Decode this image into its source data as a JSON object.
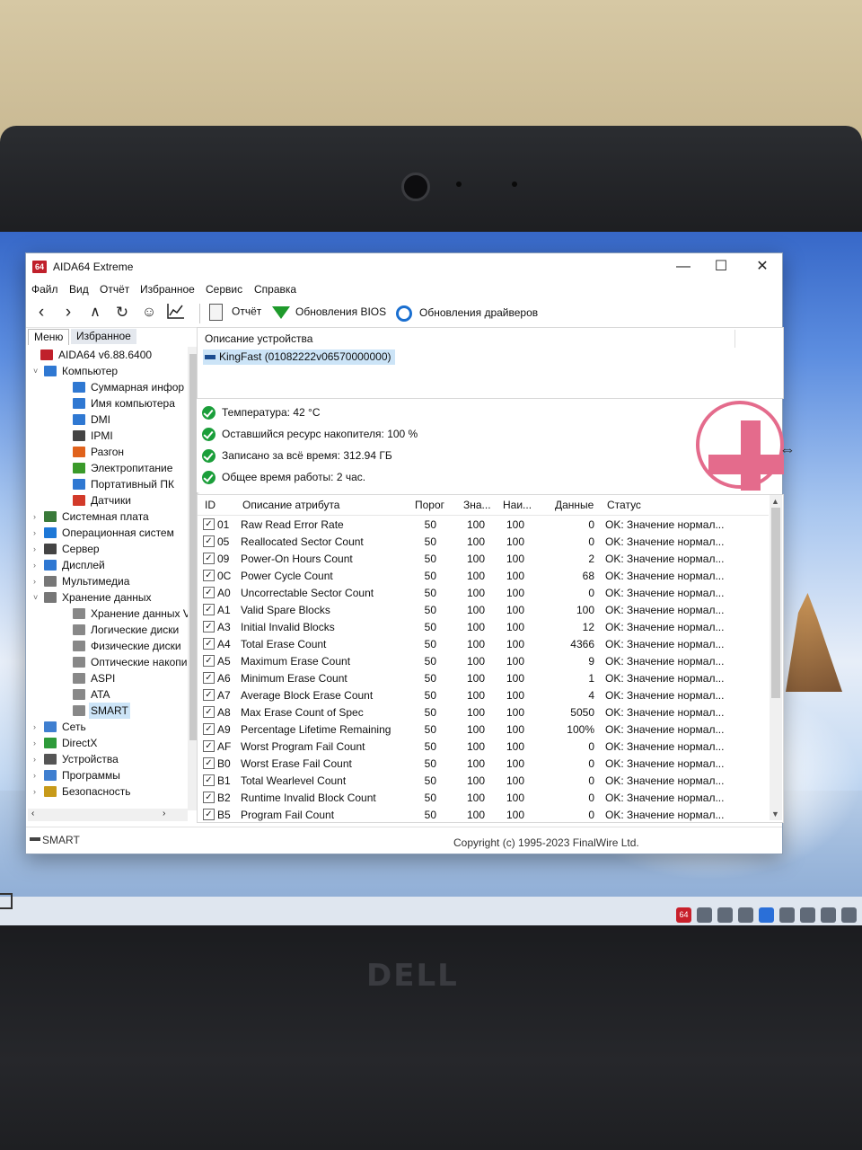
{
  "window": {
    "title": "AIDA64 Extreme",
    "logo": "64",
    "controls": [
      "—",
      "☐",
      "✕"
    ]
  },
  "menu": [
    "Файл",
    "Вид",
    "Отчёт",
    "Избранное",
    "Сервис",
    "Справка"
  ],
  "toolbar": {
    "nav_icons": [
      "back-icon",
      "forward-icon",
      "up-icon",
      "refresh-icon",
      "user-icon",
      "chart-icon"
    ],
    "report_label": "Отчёт",
    "bios_label": "Обновления BIOS",
    "drivers_label": "Обновления драйверов"
  },
  "left_tabs": {
    "menu": "Меню",
    "favorites": "Избранное"
  },
  "tree": [
    {
      "label": "AIDA64 v6.88.6400",
      "indent": 0,
      "expander": "",
      "icon": "aida-icon",
      "color": "#c0202b"
    },
    {
      "label": "Компьютер",
      "indent": 1,
      "expander": "v",
      "icon": "computer-icon",
      "color": "#2f78d2"
    },
    {
      "label": "Суммарная инфор",
      "indent": 2,
      "expander": "",
      "icon": "monitor-icon",
      "color": "#2f78d2"
    },
    {
      "label": "Имя компьютера",
      "indent": 2,
      "expander": "",
      "icon": "monitor-icon",
      "color": "#2f78d2"
    },
    {
      "label": "DMI",
      "indent": 2,
      "expander": "",
      "icon": "monitor-icon",
      "color": "#2f78d2"
    },
    {
      "label": "IPMI",
      "indent": 2,
      "expander": "",
      "icon": "server-icon",
      "color": "#444444"
    },
    {
      "label": "Разгон",
      "indent": 2,
      "expander": "",
      "icon": "flame-icon",
      "color": "#e0621c"
    },
    {
      "label": "Электропитание",
      "indent": 2,
      "expander": "",
      "icon": "power-icon",
      "color": "#3a9a2a"
    },
    {
      "label": "Портативный ПК",
      "indent": 2,
      "expander": "",
      "icon": "laptop-icon",
      "color": "#2f78d2"
    },
    {
      "label": "Датчики",
      "indent": 2,
      "expander": "",
      "icon": "gauge-icon",
      "color": "#d23a2a"
    },
    {
      "label": "Системная плата",
      "indent": 1,
      "expander": ">",
      "icon": "motherboard-icon",
      "color": "#3a7a3a"
    },
    {
      "label": "Операционная систем",
      "indent": 1,
      "expander": ">",
      "icon": "windows-icon",
      "color": "#1e78d7"
    },
    {
      "label": "Сервер",
      "indent": 1,
      "expander": ">",
      "icon": "server-icon",
      "color": "#444444"
    },
    {
      "label": "Дисплей",
      "indent": 1,
      "expander": ">",
      "icon": "display-icon",
      "color": "#2f78d2"
    },
    {
      "label": "Мультимедиа",
      "indent": 1,
      "expander": ">",
      "icon": "speaker-icon",
      "color": "#777777"
    },
    {
      "label": "Хранение данных",
      "indent": 1,
      "expander": "v",
      "icon": "storage-icon",
      "color": "#777777"
    },
    {
      "label": "Хранение данных V",
      "indent": 2,
      "expander": "",
      "icon": "disk-icon",
      "color": "#888888"
    },
    {
      "label": "Логические диски",
      "indent": 2,
      "expander": "",
      "icon": "disk-icon",
      "color": "#888888"
    },
    {
      "label": "Физические диски",
      "indent": 2,
      "expander": "",
      "icon": "disk-icon",
      "color": "#888888"
    },
    {
      "label": "Оптические накопи",
      "indent": 2,
      "expander": "",
      "icon": "optical-icon",
      "color": "#888888"
    },
    {
      "label": "ASPI",
      "indent": 2,
      "expander": "",
      "icon": "disk-icon",
      "color": "#888888"
    },
    {
      "label": "ATA",
      "indent": 2,
      "expander": "",
      "icon": "disk-icon",
      "color": "#888888"
    },
    {
      "label": "SMART",
      "indent": 2,
      "expander": "",
      "icon": "disk-icon",
      "color": "#888888",
      "selected": true
    },
    {
      "label": "Сеть",
      "indent": 1,
      "expander": ">",
      "icon": "network-icon",
      "color": "#3f7fd0"
    },
    {
      "label": "DirectX",
      "indent": 1,
      "expander": ">",
      "icon": "xbox-icon",
      "color": "#2e9b3a"
    },
    {
      "label": "Устройства",
      "indent": 1,
      "expander": ">",
      "icon": "device-icon",
      "color": "#555555"
    },
    {
      "label": "Программы",
      "indent": 1,
      "expander": ">",
      "icon": "programs-icon",
      "color": "#3f7fd0"
    },
    {
      "label": "Безопасность",
      "indent": 1,
      "expander": ">",
      "icon": "shield-icon",
      "color": "#c79a1a"
    }
  ],
  "device_desc": {
    "header": "Описание устройства",
    "device": "KingFast (01082222v06570000000)"
  },
  "summary": [
    "Температура: 42 °C",
    "Оставшийся ресурс накопителя: 100 %",
    "Записано за всё время: 312.94 ГБ",
    "Общее время работы: 2 час."
  ],
  "table": {
    "headers": {
      "id": "ID",
      "desc": "Описание атрибута",
      "thr": "Порог",
      "val": "Зна...",
      "worst": "Наи...",
      "data": "Данные",
      "status": "Статус"
    },
    "rows": [
      {
        "id": "01",
        "desc": "Raw Read Error Rate",
        "thr": "50",
        "val": "100",
        "worst": "100",
        "data": "0",
        "status": "OK: Значение нормал..."
      },
      {
        "id": "05",
        "desc": "Reallocated Sector Count",
        "thr": "50",
        "val": "100",
        "worst": "100",
        "data": "0",
        "status": "OK: Значение нормал..."
      },
      {
        "id": "09",
        "desc": "Power-On Hours Count",
        "thr": "50",
        "val": "100",
        "worst": "100",
        "data": "2",
        "status": "OK: Значение нормал..."
      },
      {
        "id": "0C",
        "desc": "Power Cycle Count",
        "thr": "50",
        "val": "100",
        "worst": "100",
        "data": "68",
        "status": "OK: Значение нормал..."
      },
      {
        "id": "A0",
        "desc": "Uncorrectable Sector Count",
        "thr": "50",
        "val": "100",
        "worst": "100",
        "data": "0",
        "status": "OK: Значение нормал..."
      },
      {
        "id": "A1",
        "desc": "Valid Spare Blocks",
        "thr": "50",
        "val": "100",
        "worst": "100",
        "data": "100",
        "status": "OK: Значение нормал..."
      },
      {
        "id": "A3",
        "desc": "Initial Invalid Blocks",
        "thr": "50",
        "val": "100",
        "worst": "100",
        "data": "12",
        "status": "OK: Значение нормал..."
      },
      {
        "id": "A4",
        "desc": "Total Erase Count",
        "thr": "50",
        "val": "100",
        "worst": "100",
        "data": "4366",
        "status": "OK: Значение нормал..."
      },
      {
        "id": "A5",
        "desc": "Maximum Erase Count",
        "thr": "50",
        "val": "100",
        "worst": "100",
        "data": "9",
        "status": "OK: Значение нормал..."
      },
      {
        "id": "A6",
        "desc": "Minimum Erase Count",
        "thr": "50",
        "val": "100",
        "worst": "100",
        "data": "1",
        "status": "OK: Значение нормал..."
      },
      {
        "id": "A7",
        "desc": "Average Block Erase Count",
        "thr": "50",
        "val": "100",
        "worst": "100",
        "data": "4",
        "status": "OK: Значение нормал..."
      },
      {
        "id": "A8",
        "desc": "Max Erase Count of Spec",
        "thr": "50",
        "val": "100",
        "worst": "100",
        "data": "5050",
        "status": "OK: Значение нормал..."
      },
      {
        "id": "A9",
        "desc": "Percentage Lifetime Remaining",
        "thr": "50",
        "val": "100",
        "worst": "100",
        "data": "100%",
        "status": "OK: Значение нормал..."
      },
      {
        "id": "AF",
        "desc": "Worst Program Fail Count",
        "thr": "50",
        "val": "100",
        "worst": "100",
        "data": "0",
        "status": "OK: Значение нормал..."
      },
      {
        "id": "B0",
        "desc": "Worst Erase Fail Count",
        "thr": "50",
        "val": "100",
        "worst": "100",
        "data": "0",
        "status": "OK: Значение нормал..."
      },
      {
        "id": "B1",
        "desc": "Total Wearlevel Count",
        "thr": "50",
        "val": "100",
        "worst": "100",
        "data": "0",
        "status": "OK: Значение нормал..."
      },
      {
        "id": "B2",
        "desc": "Runtime Invalid Block Count",
        "thr": "50",
        "val": "100",
        "worst": "100",
        "data": "0",
        "status": "OK: Значение нормал..."
      },
      {
        "id": "B5",
        "desc": "Program Fail Count",
        "thr": "50",
        "val": "100",
        "worst": "100",
        "data": "0",
        "status": "OK: Значение нормал..."
      }
    ]
  },
  "statusbar": {
    "left": "SMART",
    "copyright": "Copyright (c) 1995-2023 FinalWire Ltd."
  },
  "laptop_brand": "DELL",
  "taskbar": {
    "aida": "64",
    "tray_icons": [
      "edge-icon",
      "network-icon",
      "monitor-icon",
      "bluetooth-icon",
      "gpu-icon",
      "app-icon",
      "battery-icon",
      "wifi-icon"
    ]
  },
  "colors": {
    "ok_green": "#1b9e3a",
    "selection": "#cce4f7",
    "aida_red": "#c0202b",
    "cross_pink": "#e46b8c"
  }
}
